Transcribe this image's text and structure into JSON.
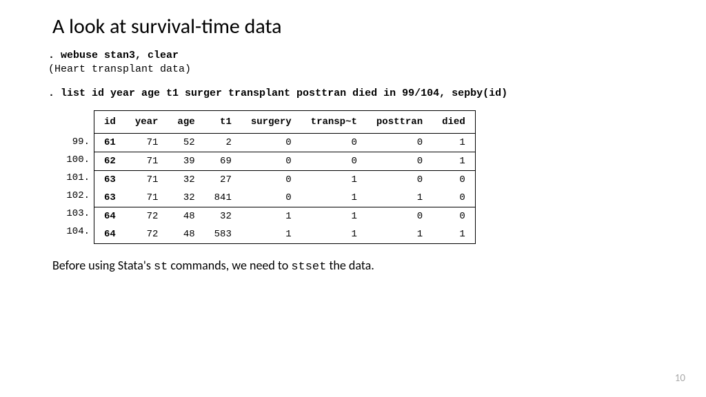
{
  "title": "A look at survival-time data",
  "code": {
    "line1": ". webuse stan3, clear",
    "line2": "(Heart transplant data)",
    "line3": ". list id year age t1 surger transplant posttran died in 99/104, sepby(id)"
  },
  "table": {
    "headers": [
      "id",
      "year",
      "age",
      "t1",
      "surgery",
      "transp~t",
      "posttran",
      "died"
    ],
    "rows": [
      {
        "n": "99.",
        "v": [
          "61",
          "71",
          "52",
          "2",
          "0",
          "0",
          "0",
          "1"
        ],
        "groupEnd": true
      },
      {
        "n": "100.",
        "v": [
          "62",
          "71",
          "39",
          "69",
          "0",
          "0",
          "0",
          "1"
        ],
        "groupEnd": true
      },
      {
        "n": "101.",
        "v": [
          "63",
          "71",
          "32",
          "27",
          "0",
          "1",
          "0",
          "0"
        ],
        "groupEnd": false
      },
      {
        "n": "102.",
        "v": [
          "63",
          "71",
          "32",
          "841",
          "0",
          "1",
          "1",
          "0"
        ],
        "groupEnd": true
      },
      {
        "n": "103.",
        "v": [
          "64",
          "72",
          "48",
          "32",
          "1",
          "1",
          "0",
          "0"
        ],
        "groupEnd": false
      },
      {
        "n": "104.",
        "v": [
          "64",
          "72",
          "48",
          "583",
          "1",
          "1",
          "1",
          "1"
        ],
        "groupEnd": false
      }
    ]
  },
  "footnote": {
    "pre": "Before using Stata's ",
    "code1": "st",
    "mid": " commands, we need to ",
    "code2": "stset",
    "post": " the data."
  },
  "pagenum": "10"
}
